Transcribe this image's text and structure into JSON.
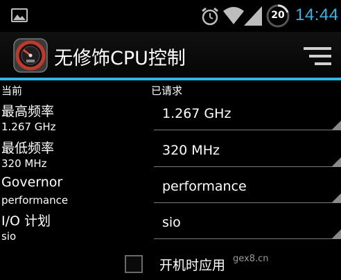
{
  "status_bar": {
    "clock": "14:44",
    "battery_level": "20",
    "icons": [
      "gallery-icon",
      "alarm-clock-icon",
      "wifi-icon",
      "signal-icon",
      "battery-icon"
    ]
  },
  "action_bar": {
    "title": "无修饰CPU控制",
    "app_icon": "speedometer-icon",
    "menu_icon": "overflow-menu-icon",
    "accent_color": "#33b5e5"
  },
  "headers": {
    "current": "当前",
    "requested": "已请求"
  },
  "rows": [
    {
      "label": "最高频率",
      "current_value": "1.267 GHz",
      "requested_value": "1.267 GHz"
    },
    {
      "label": "最低频率",
      "current_value": "320 MHz",
      "requested_value": "320 MHz"
    },
    {
      "label": "Governor",
      "current_value": "performance",
      "requested_value": "performance"
    },
    {
      "label": "I/O 计划",
      "current_value": "sio",
      "requested_value": "sio"
    }
  ],
  "boot_option": {
    "label": "开机时应用",
    "checked": false
  },
  "watermark": "gex8.cn"
}
